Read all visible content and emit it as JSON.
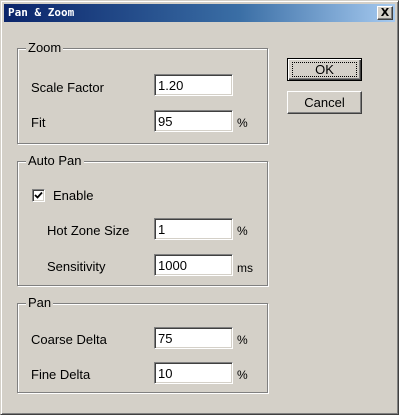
{
  "window": {
    "title": "Pan & Zoom",
    "close_symbol": "X"
  },
  "zoom": {
    "group_title": "Zoom",
    "scale_factor_label": "Scale Factor",
    "scale_factor_value": "1.20",
    "fit_label": "Fit",
    "fit_value": "95",
    "fit_unit": "%"
  },
  "auto_pan": {
    "group_title": "Auto Pan",
    "enable_label": "Enable",
    "enable_checked": true,
    "hot_zone_label": "Hot Zone Size",
    "hot_zone_value": "1",
    "hot_zone_unit": "%",
    "sensitivity_label": "Sensitivity",
    "sensitivity_value": "1000",
    "sensitivity_unit": "ms"
  },
  "pan": {
    "group_title": "Pan",
    "coarse_label": "Coarse Delta",
    "coarse_value": "75",
    "coarse_unit": "%",
    "fine_label": "Fine Delta",
    "fine_value": "10",
    "fine_unit": "%"
  },
  "buttons": {
    "ok_label": "OK",
    "cancel_label": "Cancel"
  },
  "icons": {
    "close": "close-icon",
    "check": "check-icon"
  },
  "colors": {
    "dialog_face": "#d4d0c8",
    "titlebar_start": "#0a246a",
    "titlebar_end": "#a6caf0",
    "field_bg": "#ffffff"
  }
}
